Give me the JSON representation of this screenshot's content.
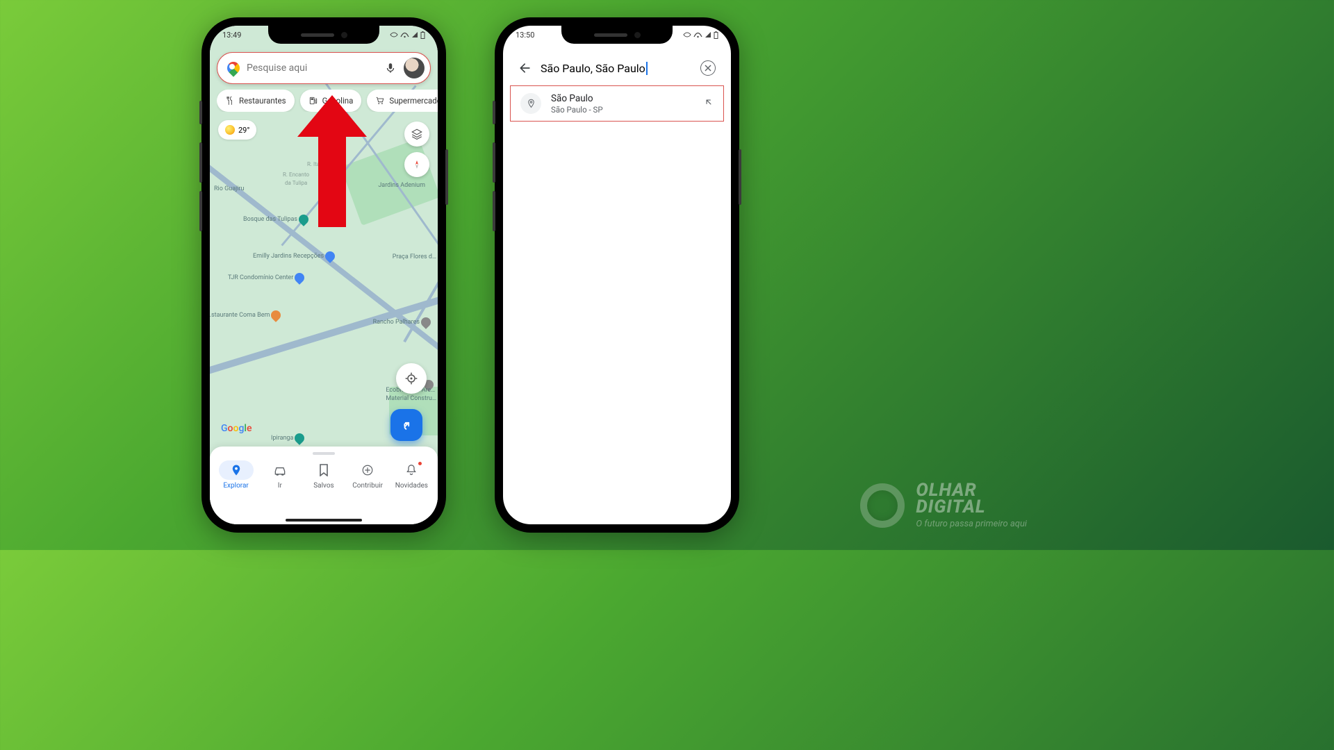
{
  "brand": {
    "name1": "OLHAR",
    "name2": "DIGITAL",
    "tagline": "O futuro passa primeiro aqui"
  },
  "phone1": {
    "status_time": "13:49",
    "search": {
      "placeholder": "Pesquise aqui"
    },
    "chips": {
      "restaurants": "Restaurantes",
      "gas": "Gasolina",
      "markets": "Supermercados"
    },
    "weather": "29°",
    "pois": {
      "guajiru": "Rio Guajiru",
      "adenium": "Jardins Adenium",
      "tulipas": "Bosque das Tulipas",
      "emilly": "Emilly Jardins Recepções",
      "tjr": "TJR Condomínio Center",
      "flores": "Praça Flores d…",
      "coma": "…staurante Coma Bem",
      "ipiranga": "Ipiranga",
      "palhares": "Rancho Palhares",
      "ecobrit1": "Ecobrit Brita Are…",
      "ecobrit2": "Material Constru…",
      "itau": "R. Itaú",
      "encanto": "R. Encanto",
      "tuli2": "da Tulipa"
    },
    "nav": {
      "explore": "Explorar",
      "go": "Ir",
      "saved": "Salvos",
      "contribute": "Contribuir",
      "updates": "Novidades"
    }
  },
  "phone2": {
    "status_time": "13:50",
    "search_value": "São Paulo, São Paulo",
    "result": {
      "title": "São Paulo",
      "subtitle": "São Paulo - SP"
    }
  }
}
